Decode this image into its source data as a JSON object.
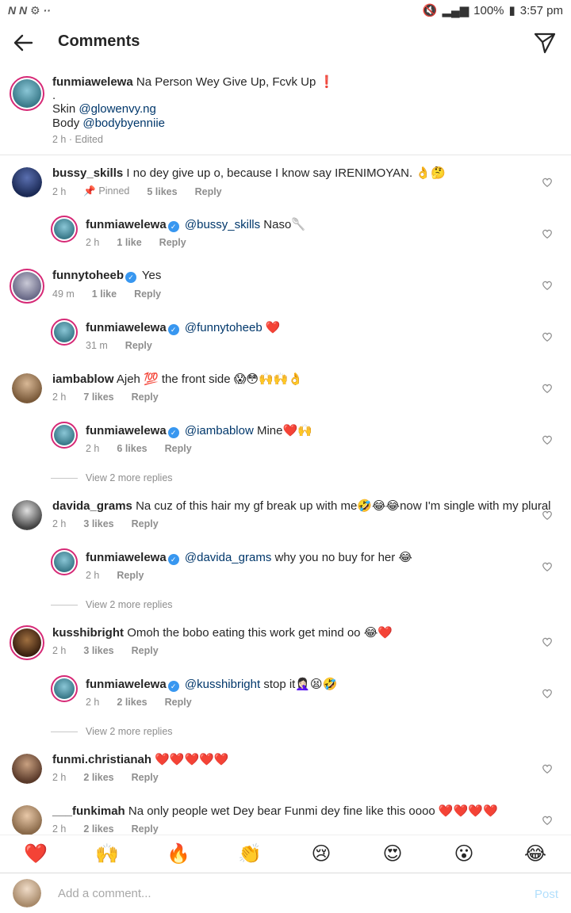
{
  "status": {
    "left": "N N ⚙ ··",
    "battery": "100%",
    "time": "3:57 pm"
  },
  "header": {
    "title": "Comments"
  },
  "caption": {
    "user": "funmiawelewa",
    "line1": "Na Person Wey Give Up, Fcvk Up ❗",
    "dot": ".",
    "skin_label": "Skin ",
    "skin_mention": "@glowenvy.ng",
    "body_label": "Body ",
    "body_mention": "@bodybyenniie",
    "meta": "2 h · Edited"
  },
  "comments": [
    {
      "user": "bussy_skills",
      "text": "I no dey give up o, because I know say IRENIMOYAN. 👌🤔",
      "time": "2 h",
      "pinned": "📌 Pinned",
      "likes": "5 likes",
      "reply": "Reply"
    },
    {
      "user": "funmiawelewa",
      "mention": "@bussy_skills",
      "text": " Naso🥄",
      "time": "2 h",
      "likes": "1 like",
      "reply": "Reply"
    },
    {
      "user": "funnytoheeb",
      "text": "Yes",
      "time": "49 m",
      "likes": "1 like",
      "reply": "Reply"
    },
    {
      "user": "funmiawelewa",
      "mention": "@funnytoheeb",
      "text": " ❤️",
      "time": "31 m",
      "reply": "Reply"
    },
    {
      "user": "iambablow",
      "text": "Ajeh 💯 the front side 😱😳🙌🙌👌",
      "time": "2 h",
      "likes": "7 likes",
      "reply": "Reply"
    },
    {
      "user": "funmiawelewa",
      "mention": "@iambablow",
      "text": " Mine❤️🙌",
      "time": "2 h",
      "likes": "6 likes",
      "reply": "Reply"
    },
    {
      "user": "davida_grams",
      "text": "Na cuz of this hair my gf break up with me🤣😂😂now I'm single with my plural",
      "time": "2 h",
      "likes": "3 likes",
      "reply": "Reply"
    },
    {
      "user": "funmiawelewa",
      "mention": "@davida_grams",
      "text": " why you no buy for her 😂",
      "time": "2 h",
      "reply": "Reply"
    },
    {
      "user": "kusshibright",
      "text": "Omoh the bobo eating this work get mind oo 😂❤️",
      "time": "2 h",
      "likes": "3 likes",
      "reply": "Reply"
    },
    {
      "user": "funmiawelewa",
      "mention": "@kusshibright",
      "text": " stop it🤦🏻‍♀️😫🤣",
      "time": "2 h",
      "likes": "2 likes",
      "reply": "Reply"
    },
    {
      "user": "funmi.christianah",
      "text": "❤️❤️❤️❤️❤️",
      "time": "2 h",
      "likes": "2 likes",
      "reply": "Reply"
    },
    {
      "user": "___funkimah",
      "text": "Na only people wet Dey bear Funmi dey fine  like this oooo ❤️❤️❤️❤️",
      "time": "2 h",
      "likes": "2 likes",
      "reply": "Reply"
    }
  ],
  "more_replies": "View 2 more replies",
  "emoji_bar": [
    "❤️",
    "🙌",
    "🔥",
    "👏",
    "😢",
    "😍",
    "😮",
    "😂"
  ],
  "composer": {
    "placeholder": "Add a comment...",
    "post": "Post"
  },
  "colors": {
    "accent": "#3897f0",
    "mention": "#00376b",
    "meta": "#8e8e8e",
    "post_disabled": "#b2dffc"
  }
}
